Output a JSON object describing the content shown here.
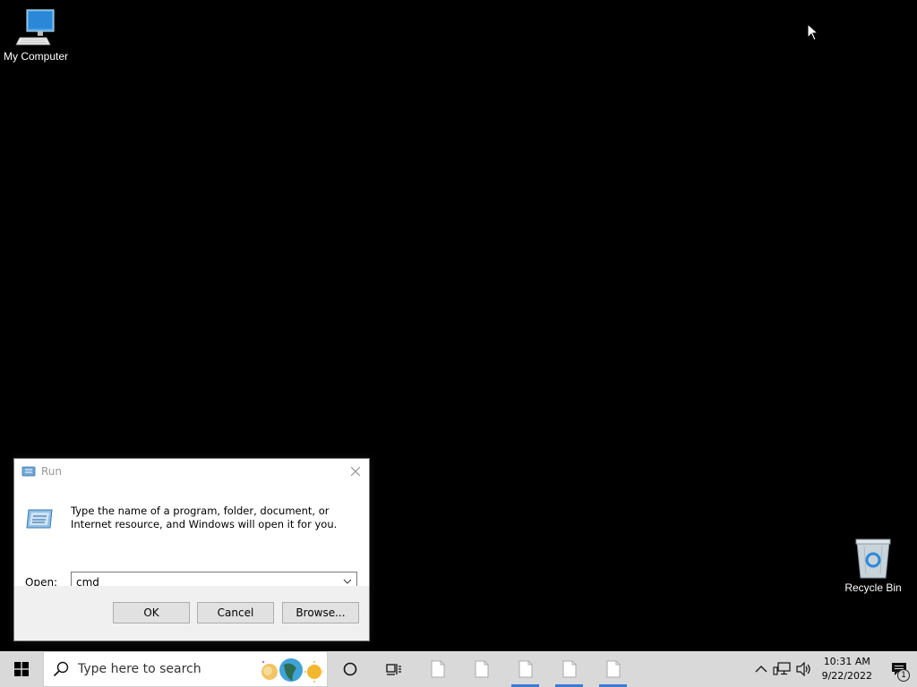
{
  "desktop": {
    "icons": [
      {
        "label": "My Computer",
        "icon": "computer-icon"
      },
      {
        "label": "Recycle Bin",
        "icon": "recycle-bin-icon"
      }
    ]
  },
  "run_dialog": {
    "title": "Run",
    "description": "Type the name of a program, folder, document, or Internet resource, and Windows will open it for you.",
    "open_label": "Open:",
    "open_value": "cmd",
    "buttons": {
      "ok": "OK",
      "cancel": "Cancel",
      "browse": "Browse..."
    }
  },
  "taskbar": {
    "search_placeholder": "Type here to search",
    "pinned": [
      {
        "icon": "cortana-icon"
      },
      {
        "icon": "task-view-icon"
      },
      {
        "icon": "document-icon",
        "active": false
      },
      {
        "icon": "document-icon",
        "active": false
      },
      {
        "icon": "document-icon",
        "active": true
      },
      {
        "icon": "document-icon",
        "active": true
      },
      {
        "icon": "document-icon",
        "active": true
      }
    ],
    "clock": {
      "time": "10:31 AM",
      "date": "9/22/2022"
    },
    "notification_count": "1"
  }
}
